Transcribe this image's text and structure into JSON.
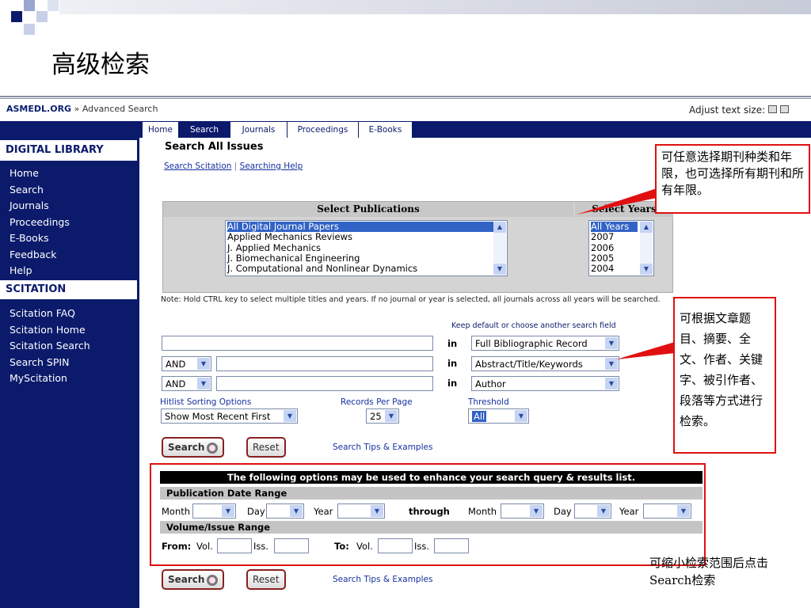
{
  "slide": {
    "title": "高级检索"
  },
  "header": {
    "site": "ASMEDL.ORG",
    "separator": "»",
    "page": "Advanced Search",
    "adjust_text": "Adjust text size:"
  },
  "tabs": [
    "Home",
    "Search",
    "Journals",
    "Proceedings",
    "E-Books"
  ],
  "sidebar": {
    "section1": "DIGITAL LIBRARY",
    "items1": [
      "Home",
      "Search",
      "Journals",
      "Proceedings",
      "E-Books",
      "Feedback",
      "Help"
    ],
    "section2": "SCITATION",
    "items2": [
      "Scitation FAQ",
      "Scitation Home",
      "Scitation Search",
      "Search SPIN",
      "MyScitation"
    ]
  },
  "main": {
    "title": "Search All Issues",
    "links": [
      "Search Scitation",
      "Searching Help"
    ],
    "pub_header": "Select Publications",
    "years_header": "Select Years",
    "publications": [
      "All Digital Journal Papers",
      "Applied Mechanics Reviews",
      "J. Applied Mechanics",
      "J. Biomechanical Engineering",
      "J. Computational and Nonlinear Dynamics"
    ],
    "years": [
      "All Years",
      "2007",
      "2006",
      "2005",
      "2004"
    ],
    "note": "Note: Hold CTRL key to select multiple titles and years. If no journal or year is selected, all journals across all years will be searched.",
    "keep_default": "Keep default or choose another search field",
    "in_label": "in",
    "rows": [
      {
        "op": "",
        "field": "Full Bibliographic Record"
      },
      {
        "op": "AND",
        "field": "Abstract/Title/Keywords"
      },
      {
        "op": "AND",
        "field": "Author"
      }
    ],
    "hitlist_label": "Hitlist Sorting Options",
    "hitlist_value": "Show Most Recent First",
    "records_label": "Records Per Page",
    "records_value": "25",
    "threshold_label": "Threshold",
    "threshold_value": "All",
    "search_btn": "Search",
    "reset_btn": "Reset",
    "tips": "Search Tips & Examples",
    "enhance": "The following options may be used to enhance your search query & results list.",
    "date_range": "Publication Date Range",
    "month": "Month",
    "day": "Day",
    "year": "Year",
    "through": "through",
    "vol_range": "Volume/Issue Range",
    "from": "From:",
    "to": "To:",
    "vol": "Vol.",
    "iss": "Iss."
  },
  "callouts": {
    "top": "可任意选择期刊种类和年限，也可选择所有期刊和所有年限。",
    "middle": "可根据文章题目、摘要、全文、作者、关键字、被引作者、段落等方式进行检索。",
    "bottom": "可缩小检索范围后点击Search检索"
  },
  "colors": {
    "navy": "#0b1a6b",
    "red": "#e01010"
  }
}
